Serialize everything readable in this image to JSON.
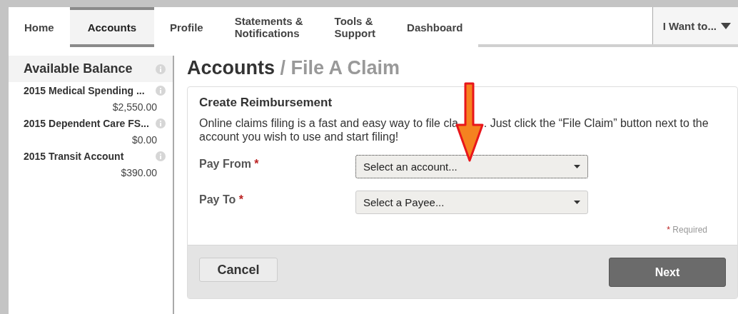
{
  "nav": {
    "tabs": [
      {
        "label": "Home",
        "selected": false
      },
      {
        "label": "Accounts",
        "selected": true
      },
      {
        "label": "Profile",
        "selected": false
      },
      {
        "label": "Statements &\nNotifications",
        "selected": false
      },
      {
        "label": "Tools &\nSupport",
        "selected": false
      },
      {
        "label": "Dashboard",
        "selected": false
      }
    ],
    "menu": {
      "label": "I Want to..."
    }
  },
  "sidebar": {
    "title": "Available Balance",
    "accounts": [
      {
        "name": "2015 Medical Spending ...",
        "balance": "$2,550.00"
      },
      {
        "name": "2015 Dependent Care FS...",
        "balance": "$0.00"
      },
      {
        "name": "2015 Transit Account",
        "balance": "$390.00"
      }
    ]
  },
  "page": {
    "breadcrumb": "Accounts",
    "title": "/ File A Claim"
  },
  "form": {
    "heading": "Create Reimbursement",
    "intro": [
      "Online claims filing is a fast and easy way to file cla",
      ". Just click the “File Claim” button next to the",
      "account you wish to use and start filing!"
    ],
    "fields": [
      {
        "label": "Pay From",
        "required_mark": "*",
        "placeholder": "Select an account...",
        "focused": true
      },
      {
        "label": "Pay To",
        "required_mark": "*",
        "placeholder": "Select a Payee...",
        "focused": false
      }
    ],
    "required_note": {
      "mark": "*",
      "text": "Required"
    },
    "buttons": [
      {
        "label": "Cancel",
        "kind": "secondary"
      },
      {
        "label": "Next",
        "kind": "primary"
      }
    ]
  },
  "annotation": {
    "kind": "arrow"
  }
}
